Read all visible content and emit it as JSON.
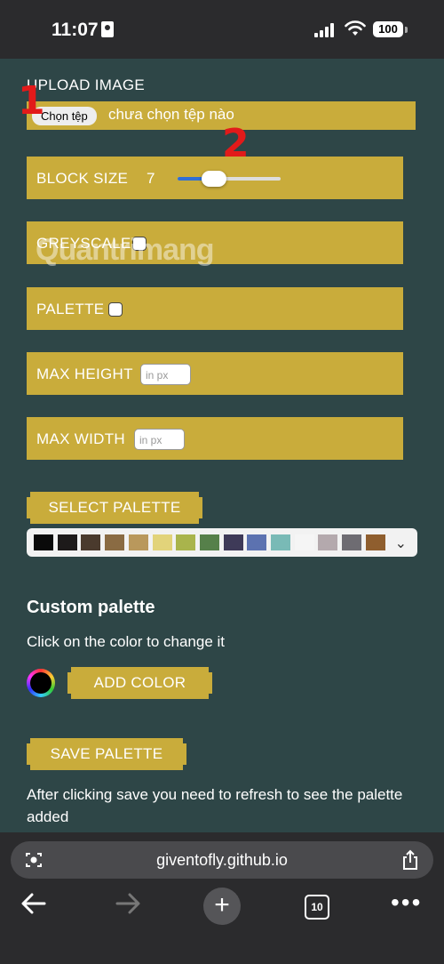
{
  "status": {
    "time": "11:07",
    "battery": "100"
  },
  "form": {
    "upload_label": "UPLOAD IMAGE",
    "file_button": "Chọn tệp",
    "file_status": "chưa chọn tệp nào",
    "block_size_label": "BLOCK SIZE",
    "block_size_value": "7",
    "block_size_slider_fraction": 0.35,
    "greyscale_label": "GREYSCALE",
    "palette_label": "PALETTE",
    "max_height_label": "MAX HEIGHT",
    "max_height_placeholder": "in px",
    "max_width_label": "MAX WIDTH",
    "max_width_placeholder": "in px"
  },
  "markers": {
    "one": "1",
    "two": "2"
  },
  "watermark": "Quantrimang",
  "palette": {
    "select_button": "SELECT PALETTE",
    "colors": [
      "#0a0a0a",
      "#1d1a1a",
      "#4a3a2d",
      "#8a6b43",
      "#b9985c",
      "#e2d37a",
      "#a9b44c",
      "#56804a",
      "#3e3a58",
      "#5c72b0",
      "#79bab6",
      "#f5f5f5",
      "#b4a9ad",
      "#6e6c72",
      "#8f5e2e"
    ]
  },
  "custom": {
    "title": "Custom palette",
    "subtitle": "Click on the color to change it",
    "add_color": "ADD COLOR",
    "save_palette": "SAVE PALETTE",
    "note": "After clicking save you need to refresh to see the palette added"
  },
  "browser": {
    "url": "giventofly.github.io",
    "tabs_count": "10"
  }
}
